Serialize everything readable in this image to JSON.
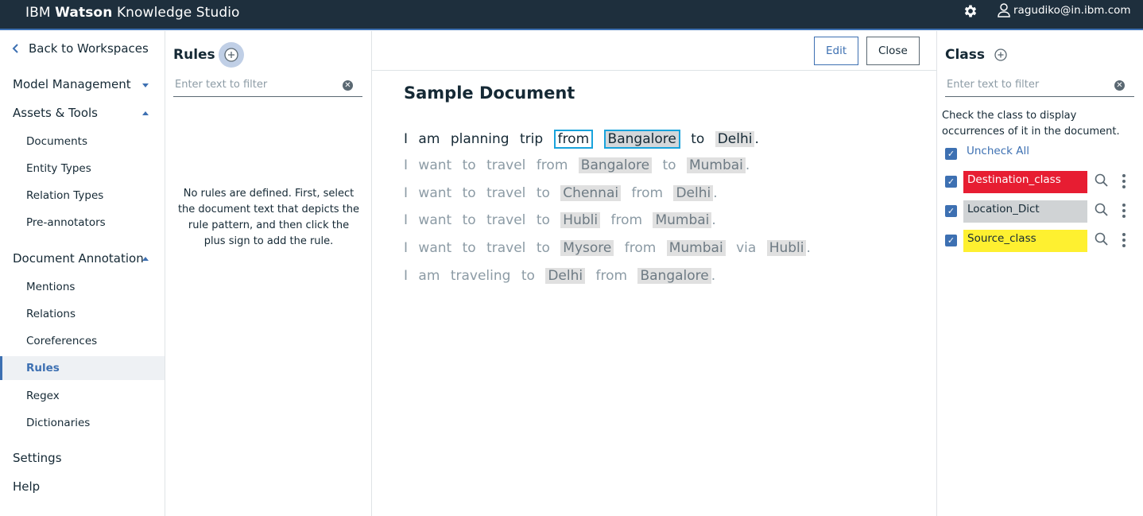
{
  "header": {
    "brand_prefix": "IBM",
    "brand_bold": "Watson",
    "brand_suffix": "Knowledge Studio",
    "user": "ragudiko@in.ibm.com",
    "background": "#1e2f3d"
  },
  "leftnav": {
    "back_label": "Back to Workspaces",
    "sections": [
      {
        "label": "Model Management",
        "expanded": false
      },
      {
        "label": "Assets & Tools",
        "expanded": true
      },
      {
        "label": "Document Annotation",
        "expanded": true
      },
      {
        "label": "Settings"
      },
      {
        "label": "Help"
      }
    ],
    "assets_items": [
      "Documents",
      "Entity Types",
      "Relation Types",
      "Pre-annotators"
    ],
    "annotation_items": [
      "Mentions",
      "Relations",
      "Coreferences",
      "Rules",
      "Regex",
      "Dictionaries"
    ],
    "active_item": "Rules"
  },
  "rules": {
    "title": "Rules",
    "filter_placeholder": "Enter text to filter",
    "empty_message": "No rules are defined. First, select the document text that depicts the rule pattern, and then click the plus sign to add the rule."
  },
  "document": {
    "edit_label": "Edit",
    "close_label": "Close",
    "title": "Sample Document",
    "sentences": [
      [
        "I",
        "am",
        "planning",
        "trip",
        "from",
        "Bangalore",
        "to",
        "Delhi",
        "."
      ],
      [
        "I",
        "want",
        "to",
        "travel",
        "from",
        "Bangalore",
        "to",
        "Mumbai",
        "."
      ],
      [
        "I",
        "want",
        "to",
        "travel",
        "to",
        "Chennai",
        "from",
        "Delhi",
        "."
      ],
      [
        "I",
        "want",
        "to",
        "travel",
        "to",
        "Hubli",
        "from",
        "Mumbai",
        "."
      ],
      [
        "I",
        "want",
        "to",
        "travel",
        "to",
        "Mysore",
        "from",
        "Mumbai",
        "via",
        "Hubli",
        "."
      ],
      [
        "I",
        "am",
        "traveling",
        "to",
        "Delhi",
        "from",
        "Bangalore",
        "."
      ]
    ],
    "selection_color": "#19a3dc"
  },
  "classes": {
    "title": "Class",
    "filter_placeholder": "Enter text to filter",
    "hint": "Check the class to display occurrences of it in the document.",
    "uncheck_all": "Uncheck All",
    "items": [
      {
        "label": "Destination_class",
        "color": "#e71d32",
        "text_color": "#ffffff",
        "checked": true
      },
      {
        "label": "Location_Dict",
        "color": "#d0d3d5",
        "text_color": "#152935",
        "checked": true
      },
      {
        "label": "Source_class",
        "color": "#fef030",
        "text_color": "#152935",
        "checked": true
      }
    ]
  }
}
